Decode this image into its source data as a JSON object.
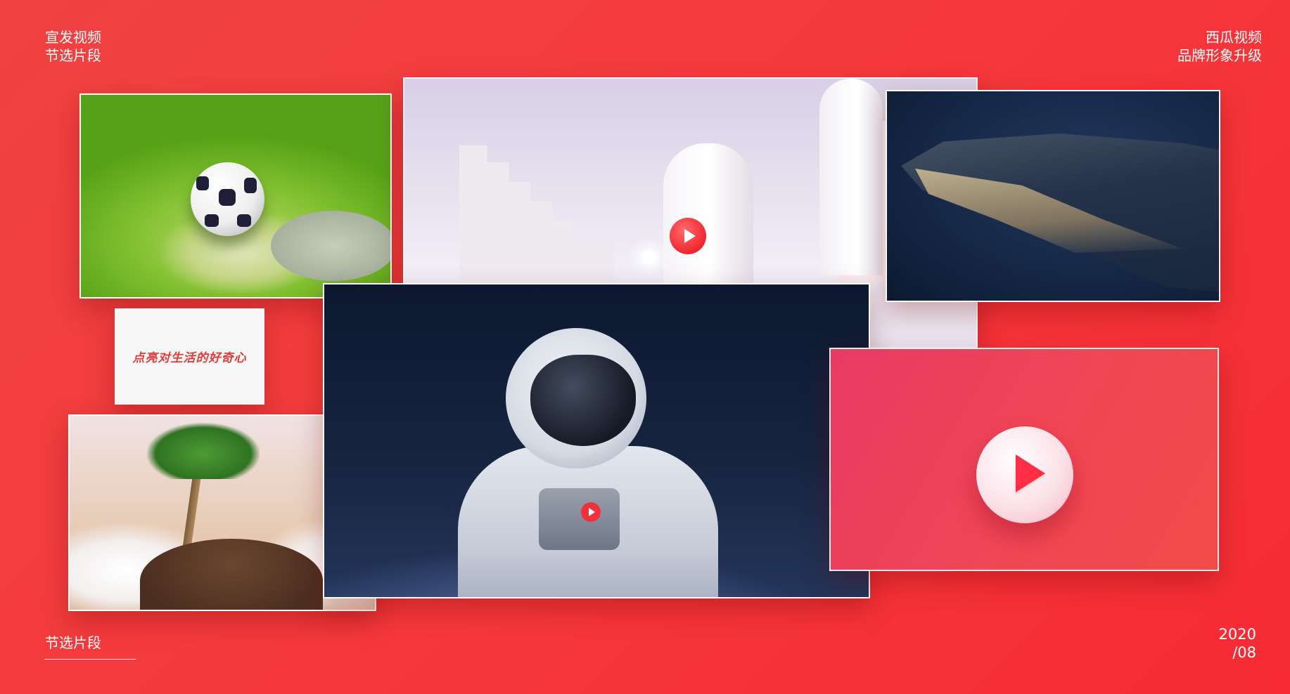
{
  "header": {
    "left_line1": "宣发视频",
    "left_line2": "节选片段",
    "right_line1": "西瓜视频",
    "right_line2": "品牌形象升级"
  },
  "footer": {
    "left_label": "节选片段",
    "date_year": "2020",
    "date_month": "/08"
  },
  "tagline": "点亮对生活的好奇心",
  "gallery": {
    "frames": [
      "soccer-ball-scene",
      "white-door-scene",
      "whale-scene",
      "tagline-card",
      "palm-island-scene",
      "astronaut-scene",
      "logo-card"
    ]
  },
  "colors": {
    "background": "#f53a3d",
    "brand_red": "#f0262f",
    "tagline_red": "#e33a3a",
    "text": "#ffffff"
  },
  "icons": {
    "brand_logo": "xigua-play-logo-icon"
  }
}
